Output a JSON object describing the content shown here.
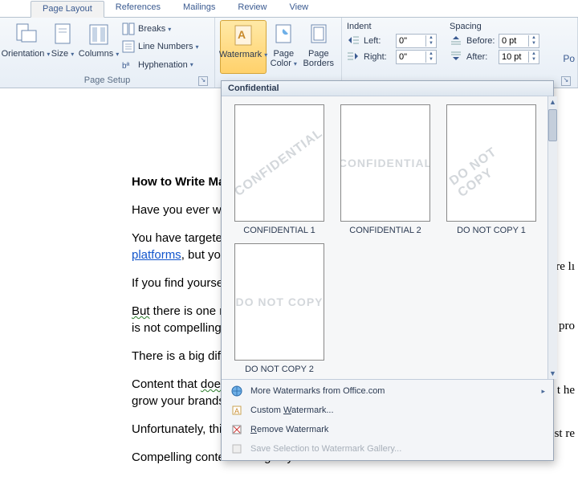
{
  "tabs": [
    "Page Layout",
    "References",
    "Mailings",
    "Review",
    "View"
  ],
  "active_tab_index": 0,
  "groups": {
    "page_setup": {
      "label": "Page Setup",
      "orientation": "Orientation",
      "size": "Size",
      "columns": "Columns",
      "breaks": "Breaks",
      "line_numbers": "Line Numbers",
      "hyphenation": "Hyphenation"
    },
    "page_bg": {
      "watermark": "Watermark",
      "page_color": "Page Color",
      "page_borders": "Page Borders"
    },
    "paragraph": {
      "indent_label": "Indent",
      "spacing_label": "Spacing",
      "left_label": "Left:",
      "right_label": "Right:",
      "before_label": "Before:",
      "after_label": "After:",
      "left_val": "0\"",
      "right_val": "0\"",
      "before_val": "0 pt",
      "after_val": "10 pt"
    }
  },
  "po": "Po",
  "gallery": {
    "header": "Confidential",
    "items": [
      {
        "text": "CONFIDENTIAL",
        "layout": "diag",
        "caption": "CONFIDENTIAL 1"
      },
      {
        "text": "CONFIDENTIAL",
        "layout": "horz",
        "caption": "CONFIDENTIAL 2"
      },
      {
        "text": "DO NOT COPY",
        "layout": "diag",
        "caption": "DO NOT COPY 1"
      },
      {
        "text": "DO NOT COPY",
        "layout": "horz",
        "caption": "DO NOT COPY 2"
      }
    ],
    "menu": {
      "more": "More Watermarks from Office.com",
      "custom": "Custom Watermark...",
      "remove": "Remove Watermark",
      "save": "Save Selection to Watermark Gallery..."
    }
  },
  "document": {
    "p1": "How to Write Marl",
    "p2": "Have you ever wond",
    "p3a": "You have targeted th",
    "p3b": "platforms",
    "p3c": ", but you o",
    "p4": "If you find yourself i",
    "p5a": "But",
    "p5b": " there is one majo",
    "p5c": "is not compelling en",
    "p6": "There is a big differe",
    "p7a": "Content that ",
    "p7b": "doesn't",
    "p7c": "grow your brands, le",
    "p8": "Unfortunately, this a",
    "p9": "Compelling content changes your reader.",
    "tail_3": "re lı",
    "tail_5": " pro",
    "tail_7": "t he",
    "tail_8": "st re"
  }
}
